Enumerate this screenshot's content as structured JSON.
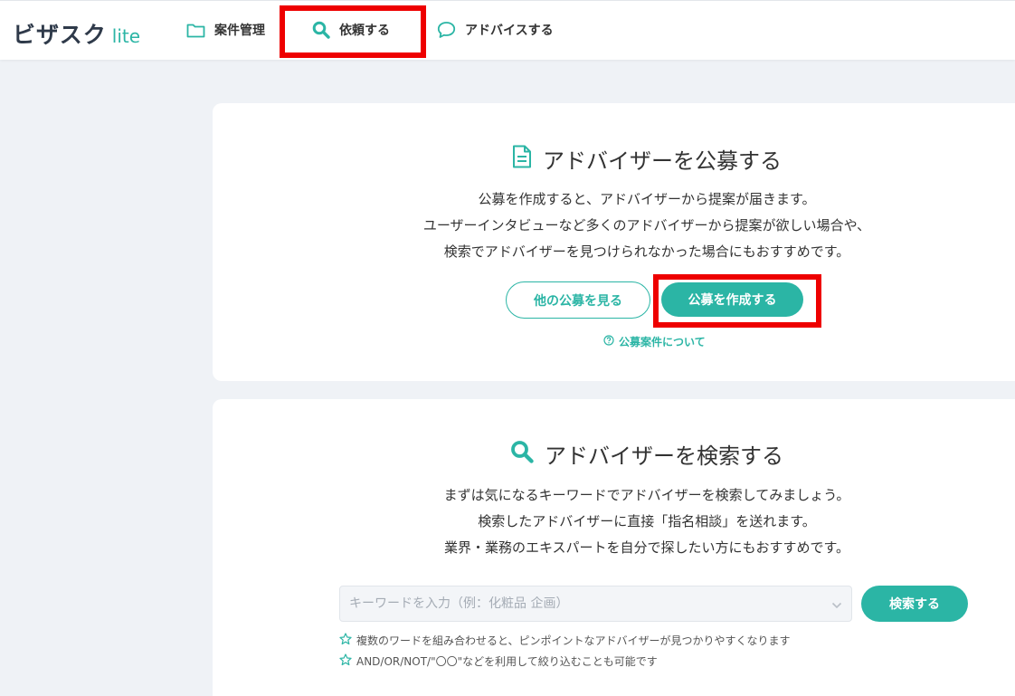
{
  "header": {
    "logo_main": "ビザスク",
    "logo_sub": "lite",
    "nav": [
      {
        "label": "案件管理",
        "icon": "folder-icon"
      },
      {
        "label": "依頼する",
        "icon": "search-icon"
      },
      {
        "label": "アドバイスする",
        "icon": "speech-bubble-icon"
      }
    ]
  },
  "recruit": {
    "title": "アドバイザーを公募する",
    "icon": "document-icon",
    "description": [
      "公募を作成すると、アドバイザーから提案が届きます。",
      "ユーザーインタビューなど多くのアドバイザーから提案が欲しい場合や、",
      "検索でアドバイザーを見つけられなかった場合にもおすすめです。"
    ],
    "view_others_label": "他の公募を見る",
    "create_label": "公募を作成する",
    "help_link": "公募案件について"
  },
  "search": {
    "title": "アドバイザーを検索する",
    "icon": "search-icon",
    "description": [
      "まずは気になるキーワードでアドバイザーを検索してみましょう。",
      "検索したアドバイザーに直接「指名相談」を送れます。",
      "業界・業務のエキスパートを自分で探したい方にもおすすめです。"
    ],
    "input_placeholder": "キーワードを入力（例：化粧品 企画）",
    "input_value": "",
    "button_label": "検索する",
    "tips": [
      "複数のワードを組み合わせると、ピンポイントなアドバイザーが見つかりやすくなります",
      "AND/OR/NOT/\"〇〇\"などを利用して絞り込むことも可能です"
    ]
  },
  "colors": {
    "accent": "#2bb5a5",
    "highlight": "#ee0000",
    "background": "#eff2f6"
  }
}
